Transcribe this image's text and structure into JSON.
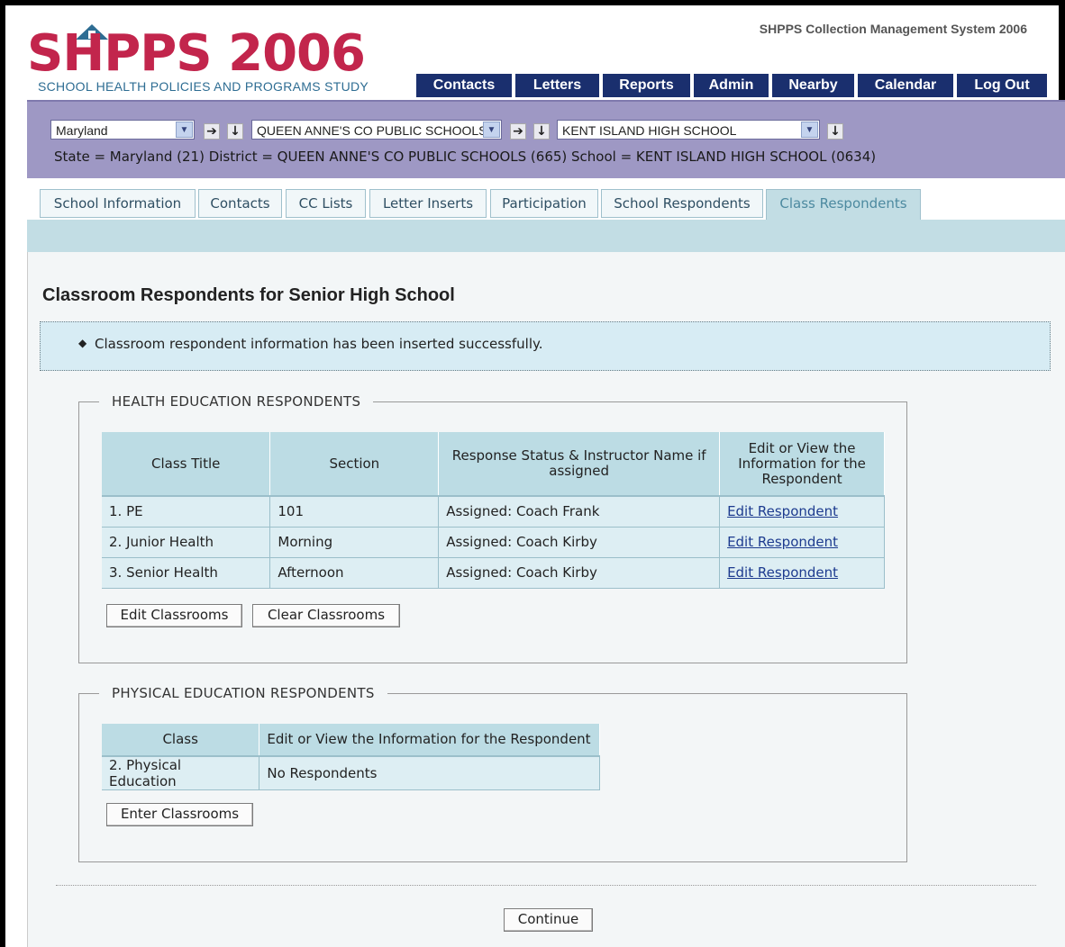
{
  "header": {
    "app_title": "SHPPS Collection Management System 2006",
    "logo_text": "SHPPS 2006",
    "logo_subtitle": "SCHOOL HEALTH POLICIES AND PROGRAMS STUDY",
    "nav": [
      "Contacts",
      "Letters",
      "Reports",
      "Admin",
      "Nearby",
      "Calendar",
      "Log Out"
    ]
  },
  "selectors": {
    "state": "Maryland",
    "district": "QUEEN ANNE'S CO PUBLIC SCHOOLS",
    "school": "KENT ISLAND HIGH SCHOOL",
    "status": "State = Maryland (21) District = QUEEN ANNE'S CO PUBLIC SCHOOLS (665) School = KENT ISLAND HIGH SCHOOL (0634)"
  },
  "tabs": [
    "School Information",
    "Contacts",
    "CC Lists",
    "Letter Inserts",
    "Participation",
    "School Respondents",
    "Class Respondents"
  ],
  "active_tab": "Class Respondents",
  "page": {
    "title": "Classroom Respondents for Senior High School",
    "message": "Classroom respondent information has been inserted successfully."
  },
  "health": {
    "legend": "HEALTH EDUCATION RESPONDENTS",
    "headers": [
      "Class Title",
      "Section",
      "Response Status & Instructor Name if assigned",
      "Edit or View the Information for the Respondent"
    ],
    "rows": [
      {
        "title": "1. PE",
        "section": "101",
        "status": "Assigned: Coach Frank",
        "link": "Edit Respondent"
      },
      {
        "title": "2. Junior Health",
        "section": "Morning",
        "status": "Assigned: Coach Kirby",
        "link": "Edit Respondent"
      },
      {
        "title": "3. Senior Health",
        "section": "Afternoon",
        "status": "Assigned: Coach Kirby",
        "link": "Edit Respondent"
      }
    ],
    "buttons": {
      "edit": "Edit Classrooms",
      "clear": "Clear Classrooms"
    }
  },
  "physical": {
    "legend": "PHYSICAL EDUCATION RESPONDENTS",
    "headers": [
      "Class",
      "Edit or View the Information for the Respondent"
    ],
    "rows": [
      {
        "class": "2. Physical Education",
        "info": "No Respondents"
      }
    ],
    "buttons": {
      "enter": "Enter Classrooms"
    }
  },
  "footer": {
    "continue": "Continue"
  },
  "colors": {
    "brand": "#c2254c",
    "nav": "#1a2f6e",
    "selector_bar": "#9e98c4",
    "tab_strip": "#c2dde4"
  }
}
